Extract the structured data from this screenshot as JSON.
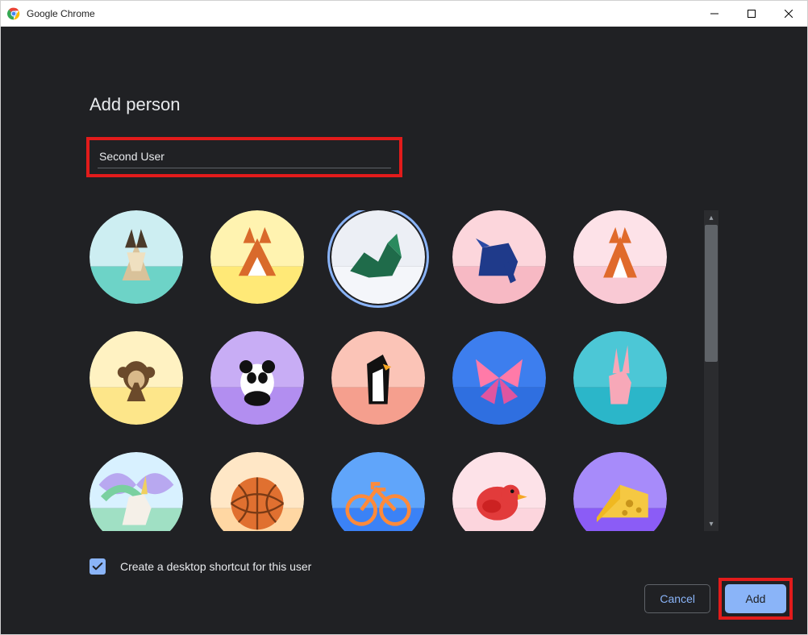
{
  "window": {
    "title": "Google Chrome"
  },
  "dialog": {
    "heading": "Add person",
    "name_value": "Second User",
    "shortcut_checked": true,
    "shortcut_label": "Create a desktop shortcut for this user",
    "cancel_label": "Cancel",
    "add_label": "Add"
  },
  "avatars": [
    {
      "name": "origami-cat",
      "selected": false,
      "bg": "#6dd3c7",
      "sky": "#cdeef2"
    },
    {
      "name": "origami-fox",
      "selected": false,
      "bg": "#ffe977",
      "sky": "#fff3b0"
    },
    {
      "name": "origami-dragon",
      "selected": true,
      "bg": "#f4f6fa",
      "sky": "#eceff5"
    },
    {
      "name": "origami-elephant",
      "selected": false,
      "bg": "#f7b9c4",
      "sky": "#fcd6dc"
    },
    {
      "name": "origami-fox-pink",
      "selected": false,
      "bg": "#f9c9d4",
      "sky": "#fde2e8"
    },
    {
      "name": "origami-monkey",
      "selected": false,
      "bg": "#fde68a",
      "sky": "#fff2c2"
    },
    {
      "name": "origami-panda",
      "selected": false,
      "bg": "#b28ef0",
      "sky": "#c8adf5"
    },
    {
      "name": "origami-penguin",
      "selected": false,
      "bg": "#f59f8e",
      "sky": "#fbc4b7"
    },
    {
      "name": "origami-butterfly",
      "selected": false,
      "bg": "#2f6fe0",
      "sky": "#3d7eee"
    },
    {
      "name": "origami-rabbit",
      "selected": false,
      "bg": "#2bb6c9",
      "sky": "#4cc7d6"
    },
    {
      "name": "origami-unicorn",
      "selected": false,
      "bg": "#a0e0c4",
      "sky": "#d8f1ff"
    },
    {
      "name": "basketball",
      "selected": false,
      "bg": "#ffd7a3",
      "sky": "#ffe7c6"
    },
    {
      "name": "bicycle",
      "selected": false,
      "bg": "#3b82f6",
      "sky": "#60a5fa"
    },
    {
      "name": "bird",
      "selected": false,
      "bg": "#fcd5dd",
      "sky": "#fde2e8"
    },
    {
      "name": "cheese",
      "selected": false,
      "bg": "#8b5cf6",
      "sky": "#a78bfa"
    }
  ]
}
